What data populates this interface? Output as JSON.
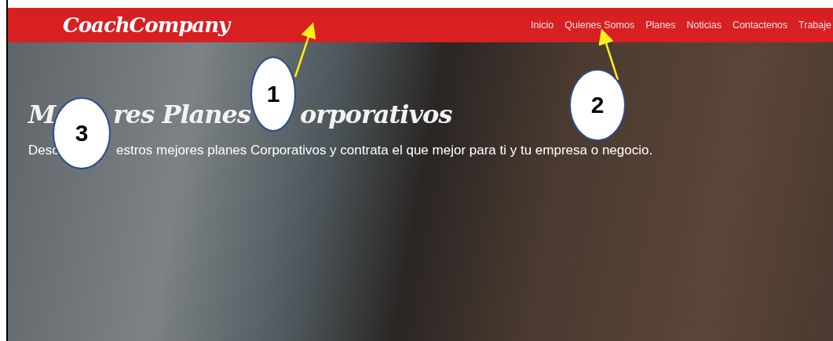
{
  "nav": {
    "logo": "CoachCompany",
    "links": [
      {
        "label": "Inicio"
      },
      {
        "label": "Quienes Somos"
      },
      {
        "label": "Planes"
      },
      {
        "label": "Noticias"
      },
      {
        "label": "Contactenos"
      },
      {
        "label": "Trabaje"
      }
    ]
  },
  "hero": {
    "title_segments": [
      "M",
      "res Planes",
      "orporativos"
    ],
    "subtitle_segments": [
      "Desc",
      "estros mejores planes Corporativos y contrata el que mejor para ti y tu empresa o negocio."
    ]
  },
  "callouts": [
    {
      "number": "1"
    },
    {
      "number": "2"
    },
    {
      "number": "3"
    }
  ]
}
